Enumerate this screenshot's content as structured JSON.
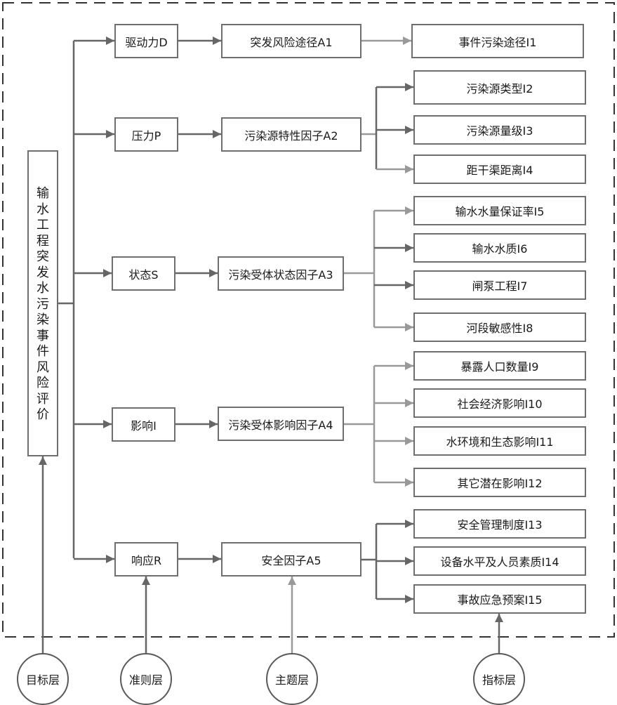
{
  "diagram": {
    "type": "hierarchy",
    "goal": {
      "label": "输水工程突发水污染事件风险评价",
      "chars": [
        "输",
        "水",
        "工",
        "程",
        "突",
        "发",
        "水",
        "污",
        "染",
        "事",
        "件",
        "风",
        "险",
        "评",
        "价"
      ]
    },
    "criteria": [
      {
        "id": "D",
        "label": "驱动力D"
      },
      {
        "id": "P",
        "label": "压力P"
      },
      {
        "id": "S",
        "label": "状态S"
      },
      {
        "id": "I",
        "label": "影响I"
      },
      {
        "id": "R",
        "label": "响应R"
      }
    ],
    "themes": [
      {
        "id": "A1",
        "label": "突发风险途径A1",
        "criterion": "D"
      },
      {
        "id": "A2",
        "label": "污染源特性因子A2",
        "criterion": "P"
      },
      {
        "id": "A3",
        "label": "污染受体状态因子A3",
        "criterion": "S"
      },
      {
        "id": "A4",
        "label": "污染受体影响因子A4",
        "criterion": "I"
      },
      {
        "id": "A5",
        "label": "安全因子A5",
        "criterion": "R"
      }
    ],
    "indicators": [
      {
        "id": "I1",
        "label": "事件污染途径I1",
        "theme": "A1"
      },
      {
        "id": "I2",
        "label": "污染源类型I2",
        "theme": "A2"
      },
      {
        "id": "I3",
        "label": "污染源量级I3",
        "theme": "A2"
      },
      {
        "id": "I4",
        "label": "距干渠距离I4",
        "theme": "A2"
      },
      {
        "id": "I5",
        "label": "输水水量保证率I5",
        "theme": "A3"
      },
      {
        "id": "I6",
        "label": "输水水质I6",
        "theme": "A3"
      },
      {
        "id": "I7",
        "label": "闸泵工程I7",
        "theme": "A3"
      },
      {
        "id": "I8",
        "label": "河段敏感性I8",
        "theme": "A3"
      },
      {
        "id": "I9",
        "label": "暴露人口数量I9",
        "theme": "A4"
      },
      {
        "id": "I10",
        "label": "社会经济影响I10",
        "theme": "A4"
      },
      {
        "id": "I11",
        "label": "水环境和生态影响I11",
        "theme": "A4"
      },
      {
        "id": "I12",
        "label": "其它潜在影响I12",
        "theme": "A4"
      },
      {
        "id": "I13",
        "label": "安全管理制度I13",
        "theme": "A5"
      },
      {
        "id": "I14",
        "label": "设备水平及人员素质I14",
        "theme": "A5"
      },
      {
        "id": "I15",
        "label": "事故应急预案I15",
        "theme": "A5"
      }
    ],
    "layers": [
      {
        "id": "goal",
        "label": "目标层"
      },
      {
        "id": "criteria",
        "label": "准则层"
      },
      {
        "id": "theme",
        "label": "主题层"
      },
      {
        "id": "indicator",
        "label": "指标层"
      }
    ],
    "colors": {
      "line_dark": "#666666",
      "line_light": "#999999",
      "border": "#6e6e6e",
      "dashed_frame": "#333333"
    }
  }
}
